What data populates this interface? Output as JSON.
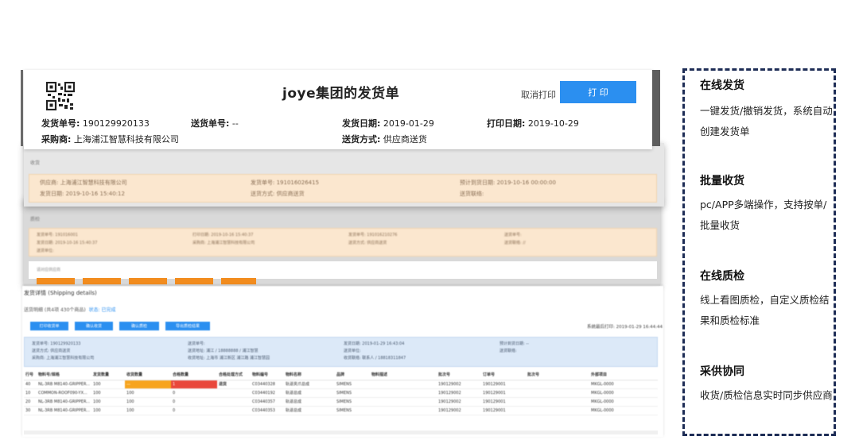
{
  "document": {
    "title": "joye集团的发货单",
    "cancel_print": "取消打印",
    "print": "打 印",
    "fields": {
      "ship_no_label": "发货单号:",
      "ship_no": "190129920133",
      "delivery_no_label": "送货单号:",
      "delivery_no": "--",
      "ship_date_label": "发货日期:",
      "ship_date": "2019-01-29",
      "print_date_label": "打印日期:",
      "print_date": "2019-10-29",
      "buyer_label": "采购商:",
      "buyer": "上海浦江智慧科技有限公司",
      "delivery_method_label": "送货方式:",
      "delivery_method": "供应商送货"
    }
  },
  "receipt": {
    "section_label": "收货",
    "supplier": "供应商: 上海浦江智慧科技有限公司",
    "ship_date": "发货日期: 2019-10-16 15:40:12",
    "ship_no": "发货单号: 191016026415",
    "method": "送货方式: 供应商送货",
    "expected": "预计到货日期: 2019-10-16 00:00:00",
    "contact": "送货联络:"
  },
  "qc": {
    "section_label": "质检",
    "c1a": "发货单号: 191016001",
    "c1b": "发货日期: 2019-10-16 15:40:37",
    "c1c": "送货单位:",
    "c2a": "打印日期: 2019-10-16 15:40:37",
    "c2b": "采购商: 上海浦江智慧科技有限公司",
    "c3a": "发货单号: 191016210276",
    "c3b": "送货方式: 供应商送货",
    "c4a": "送货单号:",
    "c4b": "送货联络: //",
    "sub_label": "请对应供应商"
  },
  "details": {
    "title": "发货详情 (Shipping details)",
    "sub_prefix": "送货明细 (共4项 430个商品)",
    "status": "状态: 已完成",
    "buttons": [
      "打印收货单",
      "确认收货",
      "确认质检",
      "导出质检结果"
    ],
    "print_date": "系统最后打印: 2019-01-29 16:44:44",
    "info": {
      "a1": "发货单号: 190129920133",
      "a2": "送货方式: 供应商送货",
      "a3": "采购商: 上海浦江智慧科技有限公司",
      "b1": "送货单号:",
      "b2": "送货地址: 浦江 / 18888888 / 浦江智慧",
      "b3": "收货地址: 上海市 浦江新区 浦江路 浦江智慧园",
      "c1": "发货日期: 2019-01-29 16:43:04",
      "c2": "送货单位:",
      "c3": "收货联络: 联系人 / 18818311847",
      "d1": "预计到货日期: --",
      "d2": "送货联络:"
    },
    "columns": [
      "行号",
      "物料号/规格",
      "发货数量",
      "收货数量",
      "合格数量",
      "合格处理方式",
      "物料编号",
      "物料名称",
      "品牌",
      "物料描述",
      "批次号",
      "订单号",
      "批次号",
      "外部项目"
    ],
    "rows": [
      [
        "40",
        "NL-3RB M8140-GRIPPER...",
        "100",
        "—",
        "1",
        "退货",
        "C03440328",
        "轨道夹爪总成",
        "SIMENS",
        "",
        "190129002",
        "190129001",
        "",
        "MKGL-0000"
      ],
      [
        "10",
        "COMMON-ROOF090-YX...",
        "100",
        "100",
        "0",
        "",
        "C03440192",
        "轨道总成",
        "SIMENS",
        "",
        "190129002",
        "190129001",
        "",
        "MKGL-0000"
      ],
      [
        "20",
        "NL-3RB M8140-GRIPPER...",
        "100",
        "100",
        "0",
        "",
        "C03440357",
        "轨道总成",
        "SIMENS",
        "",
        "190129002",
        "190129001",
        "",
        "MKGL-0000"
      ],
      [
        "30",
        "NL-3RB M8140-GRIPPER...",
        "100",
        "100",
        "0",
        "",
        "C03440353",
        "轨道总成",
        "SIMENS",
        "",
        "190129002",
        "190129001",
        "",
        "MKGL-0000"
      ]
    ]
  },
  "features": [
    {
      "title": "在线发货",
      "desc": "一键发货/撤销发货，系统自动创建发货单"
    },
    {
      "title": "批量收货",
      "desc": "pc/APP多端操作，支持按单/批量收货"
    },
    {
      "title": "在线质检",
      "desc": "线上看图质检，自定义质检结果和质检标准"
    },
    {
      "title": "采供协同",
      "desc": "收货/质检信息实时同步供应商"
    }
  ],
  "colors": {
    "primary": "#2b8ff0",
    "orange": "#f28c1e",
    "red": "#e9473b",
    "panel_border": "#1e2d56"
  }
}
